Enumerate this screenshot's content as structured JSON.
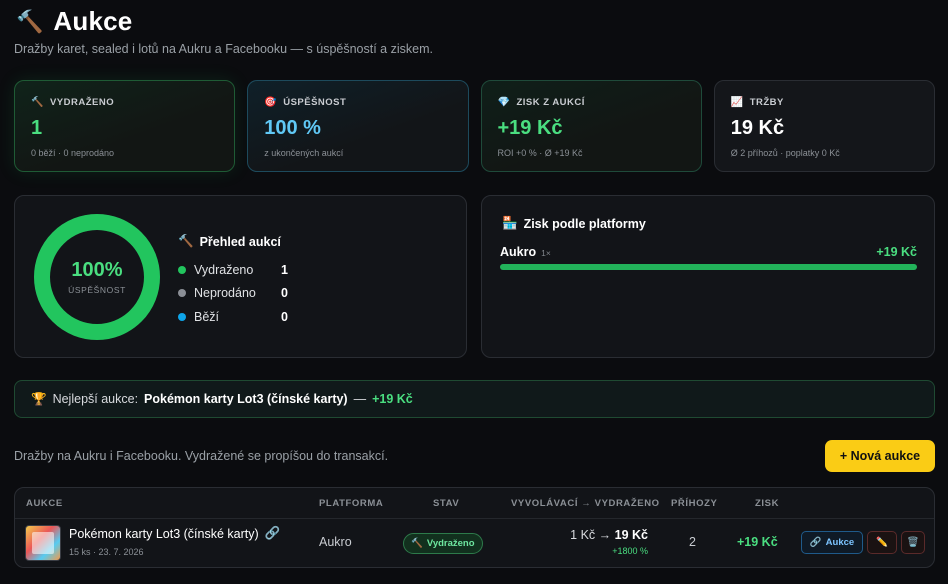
{
  "header": {
    "icon": "hammer-icon",
    "title": "Aukce",
    "subtitle": "Dražby karet, sealed i lotů na Aukru a Facebooku — s úspěšností a ziskem."
  },
  "stats": [
    {
      "icon": "🔨",
      "label": "VYDRAŽENO",
      "value": "1",
      "sub": "0 běží · 0 neprodáno"
    },
    {
      "icon": "🎯",
      "label": "ÚSPĚŠNOST",
      "value": "100 %",
      "sub": "z ukončených aukcí"
    },
    {
      "icon": "💎",
      "label": "ZISK Z AUKCÍ",
      "value": "+19 Kč",
      "sub": "ROI +0 % · Ø +19 Kč"
    },
    {
      "icon": "📈",
      "label": "TRŽBY",
      "value": "19 Kč",
      "sub": "Ø 2 příhozů · poplatky 0 Kč"
    }
  ],
  "overview": {
    "donut_value": "100%",
    "donut_fraction": 1.0,
    "donut_label": "ÚSPĚŠNOST",
    "title_icon": "🔨",
    "title": "Přehled aukcí",
    "legend": [
      {
        "label": "Vydraženo",
        "value": "1",
        "color": "#22c55e"
      },
      {
        "label": "Neprodáno",
        "value": "0",
        "color": "#8b8f96"
      },
      {
        "label": "Běží",
        "value": "0",
        "color": "#0ea5e9"
      }
    ]
  },
  "platform_panel": {
    "title_icon": "🏪",
    "title": "Zisk podle platformy",
    "rows": [
      {
        "name": "Aukro",
        "count": "1×",
        "value": "+19 Kč",
        "fraction": 1.0
      }
    ]
  },
  "best": {
    "icon": "🏆",
    "label": "Nejlepší aukce:",
    "name": "Pokémon karty Lot3 (čínské karty)",
    "separator": "—",
    "value": "+19 Kč"
  },
  "info_text": "Dražby na Aukru i Facebooku. Vydražené se propíšou do transakcí.",
  "new_button_label": "+ Nová aukce",
  "table": {
    "headers": {
      "auction": "AUKCE",
      "platform": "PLATFORMA",
      "status": "STAV",
      "price": "VYVOLÁVACÍ → VYDRAŽENO",
      "bids": "PŘÍHOZY",
      "profit": "ZISK"
    },
    "rows": [
      {
        "name": "Pokémon karty Lot3 (čínské karty)",
        "link_icon": "🔗",
        "meta": "15 ks · 23. 7. 2026",
        "platform": "Aukro",
        "status": "Vydraženo",
        "status_icon": "🔨",
        "start_price": "1 Kč",
        "arrow": "→",
        "final_price": "19 Kč",
        "roi": "+1800 %",
        "bids": "2",
        "profit": "+19 Kč",
        "action_link_label": "Aukce",
        "action_link_icon": "🔗",
        "edit_icon": "✏️",
        "delete_icon": "🗑️"
      }
    ]
  }
}
